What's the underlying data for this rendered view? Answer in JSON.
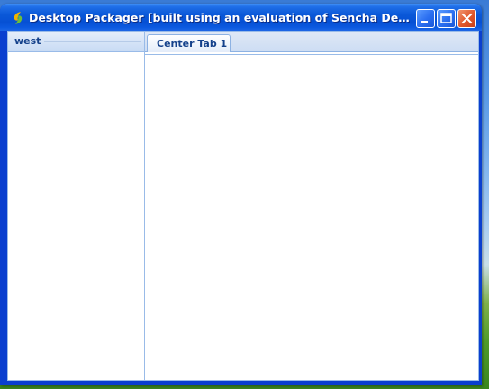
{
  "window": {
    "title": "Desktop Packager [built using an evaluation of Sencha Desktop Packager]",
    "app_icon": "app-leaf-icon",
    "controls": {
      "minimize_icon": "minimize-icon",
      "maximize_icon": "maximize-icon",
      "close_icon": "close-icon"
    },
    "accent_color": "#0a58d8",
    "close_color": "#e0562b"
  },
  "west_panel": {
    "title": "west"
  },
  "center_panel": {
    "tabs": [
      {
        "label": "Center Tab 1",
        "active": true
      }
    ]
  },
  "theme": {
    "panel_border": "#99bbe8",
    "header_text": "#15428b"
  }
}
